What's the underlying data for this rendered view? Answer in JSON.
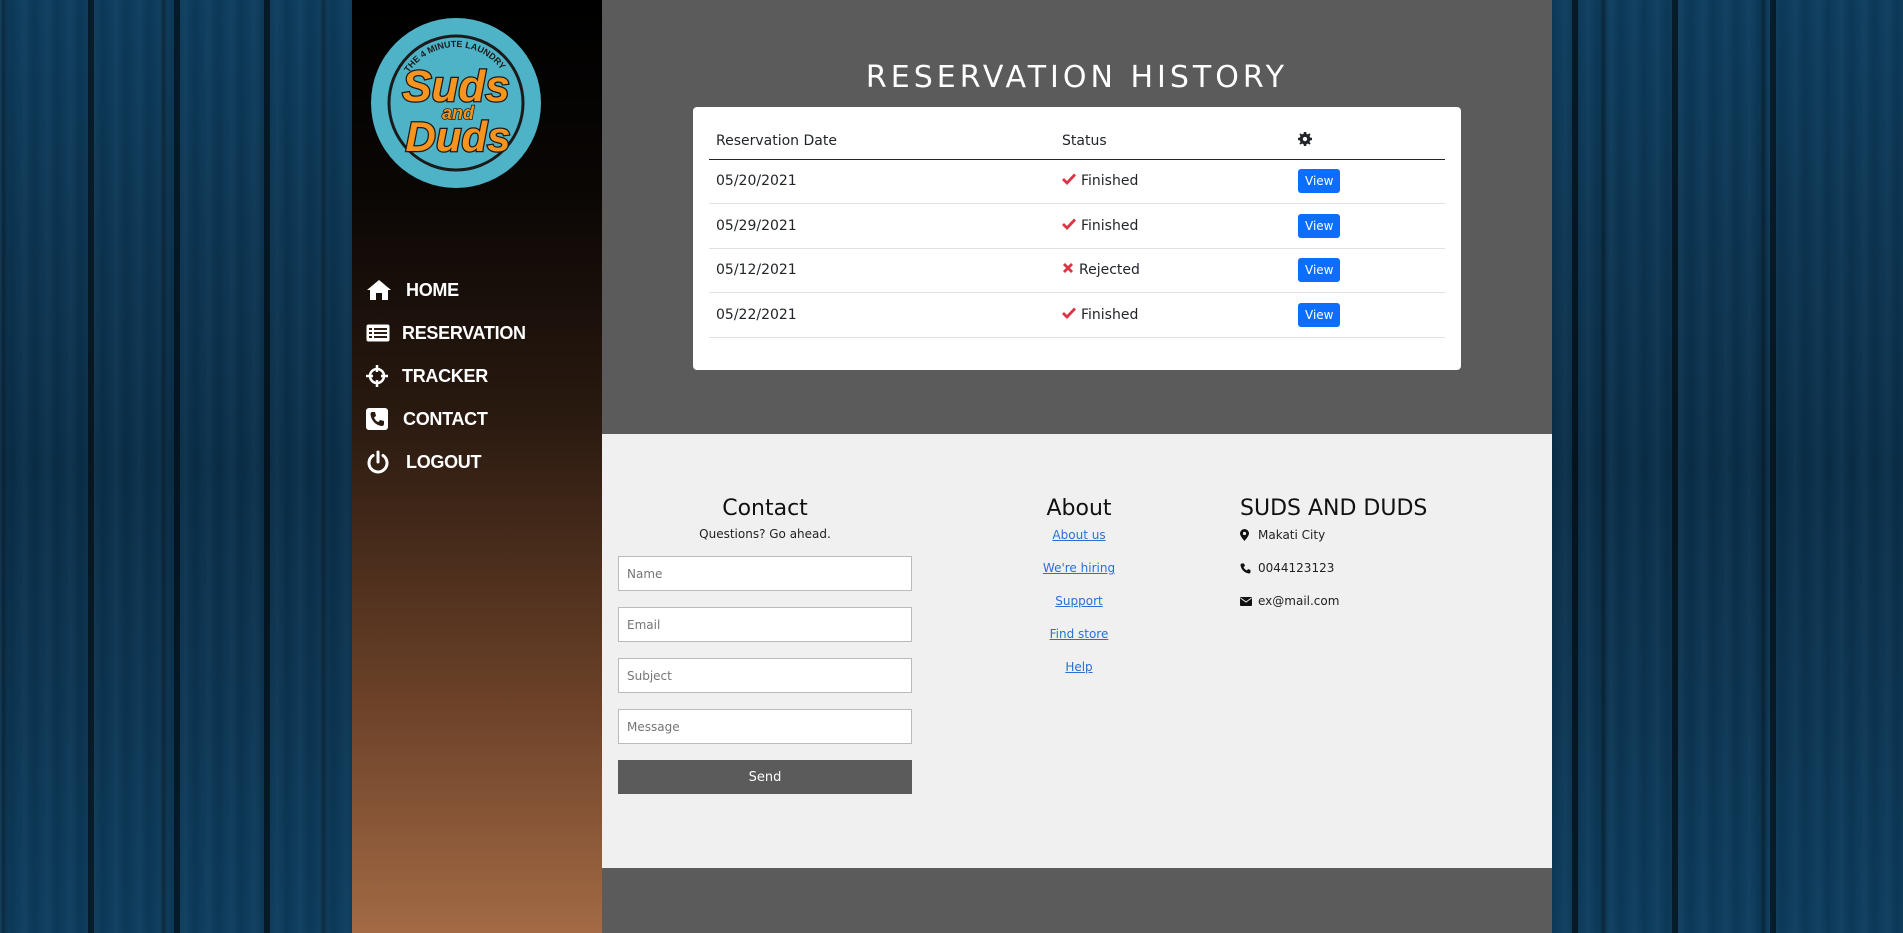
{
  "logo": {
    "tagline": "THE 4 MINUTE LAUNDRY",
    "line1": "Suds",
    "line2": "and",
    "line3": "Duds"
  },
  "nav": [
    {
      "label": "HOME",
      "icon": "home-icon"
    },
    {
      "label": "RESERVATION",
      "icon": "list-icon"
    },
    {
      "label": "TRACKER",
      "icon": "crosshairs-icon"
    },
    {
      "label": "CONTACT",
      "icon": "phone-icon"
    },
    {
      "label": "LOGOUT",
      "icon": "power-icon"
    }
  ],
  "page_title": "RESERVATION HISTORY",
  "table": {
    "headers": {
      "date": "Reservation Date",
      "status": "Status",
      "actions_icon": "gear-icon"
    },
    "rows": [
      {
        "date": "05/20/2021",
        "status": "Finished",
        "status_icon": "check-icon",
        "action": "View"
      },
      {
        "date": "05/29/2021",
        "status": "Finished",
        "status_icon": "check-icon",
        "action": "View"
      },
      {
        "date": "05/12/2021",
        "status": "Rejected",
        "status_icon": "x-icon",
        "action": "View"
      },
      {
        "date": "05/22/2021",
        "status": "Finished",
        "status_icon": "check-icon",
        "action": "View"
      }
    ]
  },
  "footer": {
    "contact": {
      "heading": "Contact",
      "subtitle": "Questions? Go ahead.",
      "name_placeholder": "Name",
      "email_placeholder": "Email",
      "subject_placeholder": "Subject",
      "message_placeholder": "Message",
      "send_label": "Send"
    },
    "about": {
      "heading": "About",
      "links": [
        "About us",
        "We're hiring",
        "Support",
        "Find store",
        "Help"
      ]
    },
    "brand": {
      "heading": "SUDS AND DUDS",
      "location": "Makati City",
      "phone": "0044123123",
      "email": "ex@mail.com"
    }
  },
  "colors": {
    "accent_blue": "#0d6efd",
    "status_red": "#dc3545",
    "panel_gray": "#5b5b5b",
    "footer_bg": "#f0f0f0"
  }
}
